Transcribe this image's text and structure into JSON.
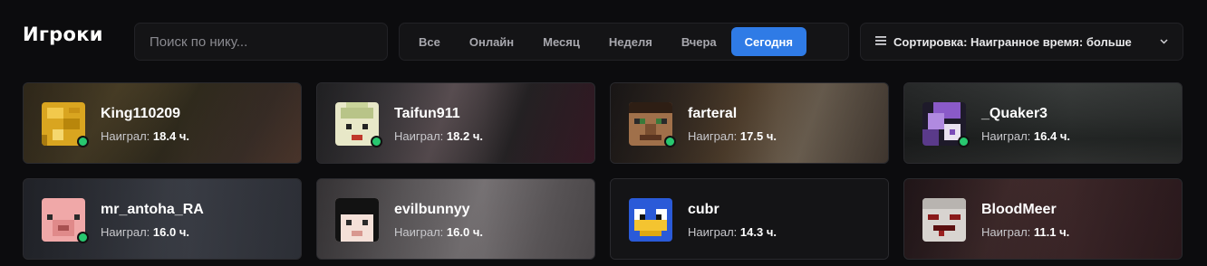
{
  "header": {
    "title": "Игроки"
  },
  "search": {
    "placeholder": "Поиск по нику..."
  },
  "filters": {
    "items": [
      {
        "label": "Все",
        "active": false
      },
      {
        "label": "Онлайн",
        "active": false
      },
      {
        "label": "Месяц",
        "active": false
      },
      {
        "label": "Неделя",
        "active": false
      },
      {
        "label": "Вчера",
        "active": false
      },
      {
        "label": "Сегодня",
        "active": true
      }
    ]
  },
  "sort": {
    "label": "Сортировка: Наигранное время: больше",
    "icon": "list-icon",
    "chevron": "chevron-down-icon"
  },
  "played_prefix": "Наиграл:",
  "players": [
    {
      "name": "King110209",
      "hours": "18.4 ч.",
      "online": true
    },
    {
      "name": "Taifun911",
      "hours": "18.2 ч.",
      "online": true
    },
    {
      "name": "farteral",
      "hours": "17.5 ч.",
      "online": true
    },
    {
      "name": "_Quaker3",
      "hours": "16.4 ч.",
      "online": true
    },
    {
      "name": "mr_antoha_RA",
      "hours": "16.0 ч.",
      "online": true
    },
    {
      "name": "evilbunnyy",
      "hours": "16.0 ч.",
      "online": false
    },
    {
      "name": "cubr",
      "hours": "14.3 ч.",
      "online": false
    },
    {
      "name": "BloodMeer",
      "hours": "11.1 ч.",
      "online": false
    }
  ],
  "colors": {
    "accent": "#2f7be6",
    "online": "#28c76f",
    "background": "#0c0c0e"
  }
}
